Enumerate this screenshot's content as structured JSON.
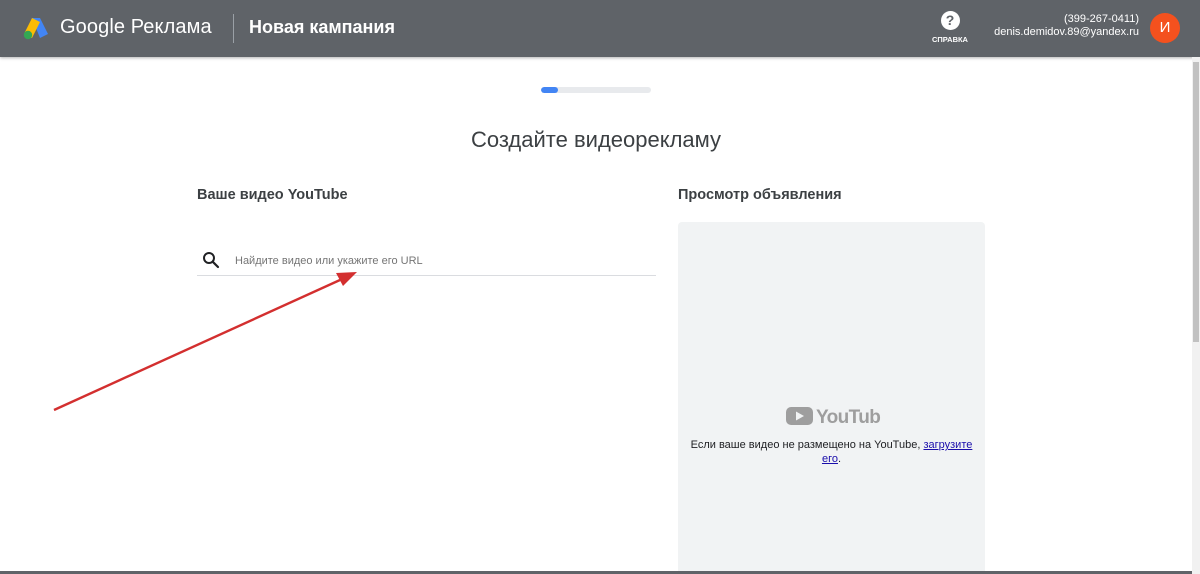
{
  "header": {
    "brand": "Google Реклама",
    "campaign_title": "Новая кампания",
    "help_label": "СПРАВКА",
    "account_phone": "(399-267-0411)",
    "account_email": "denis.demidov.89@yandex.ru",
    "avatar_letter": "И"
  },
  "progress": {
    "value_fraction": 0.15,
    "color": "#4285f4"
  },
  "main": {
    "title": "Создайте видеорекламу",
    "video_section_label": "Ваше видео YouTube",
    "search_placeholder": "Найдите видео или укажите его URL",
    "preview_section_label": "Просмотр объявления",
    "preview_logo_text": "YouTube",
    "preview_text": "Если ваше видео не размещено на YouTube,",
    "upload_link_part1": "загрузите",
    "upload_link_part2": "его",
    "upload_suffix": "."
  },
  "annotation": {
    "arrow_color": "#d32f2f"
  }
}
